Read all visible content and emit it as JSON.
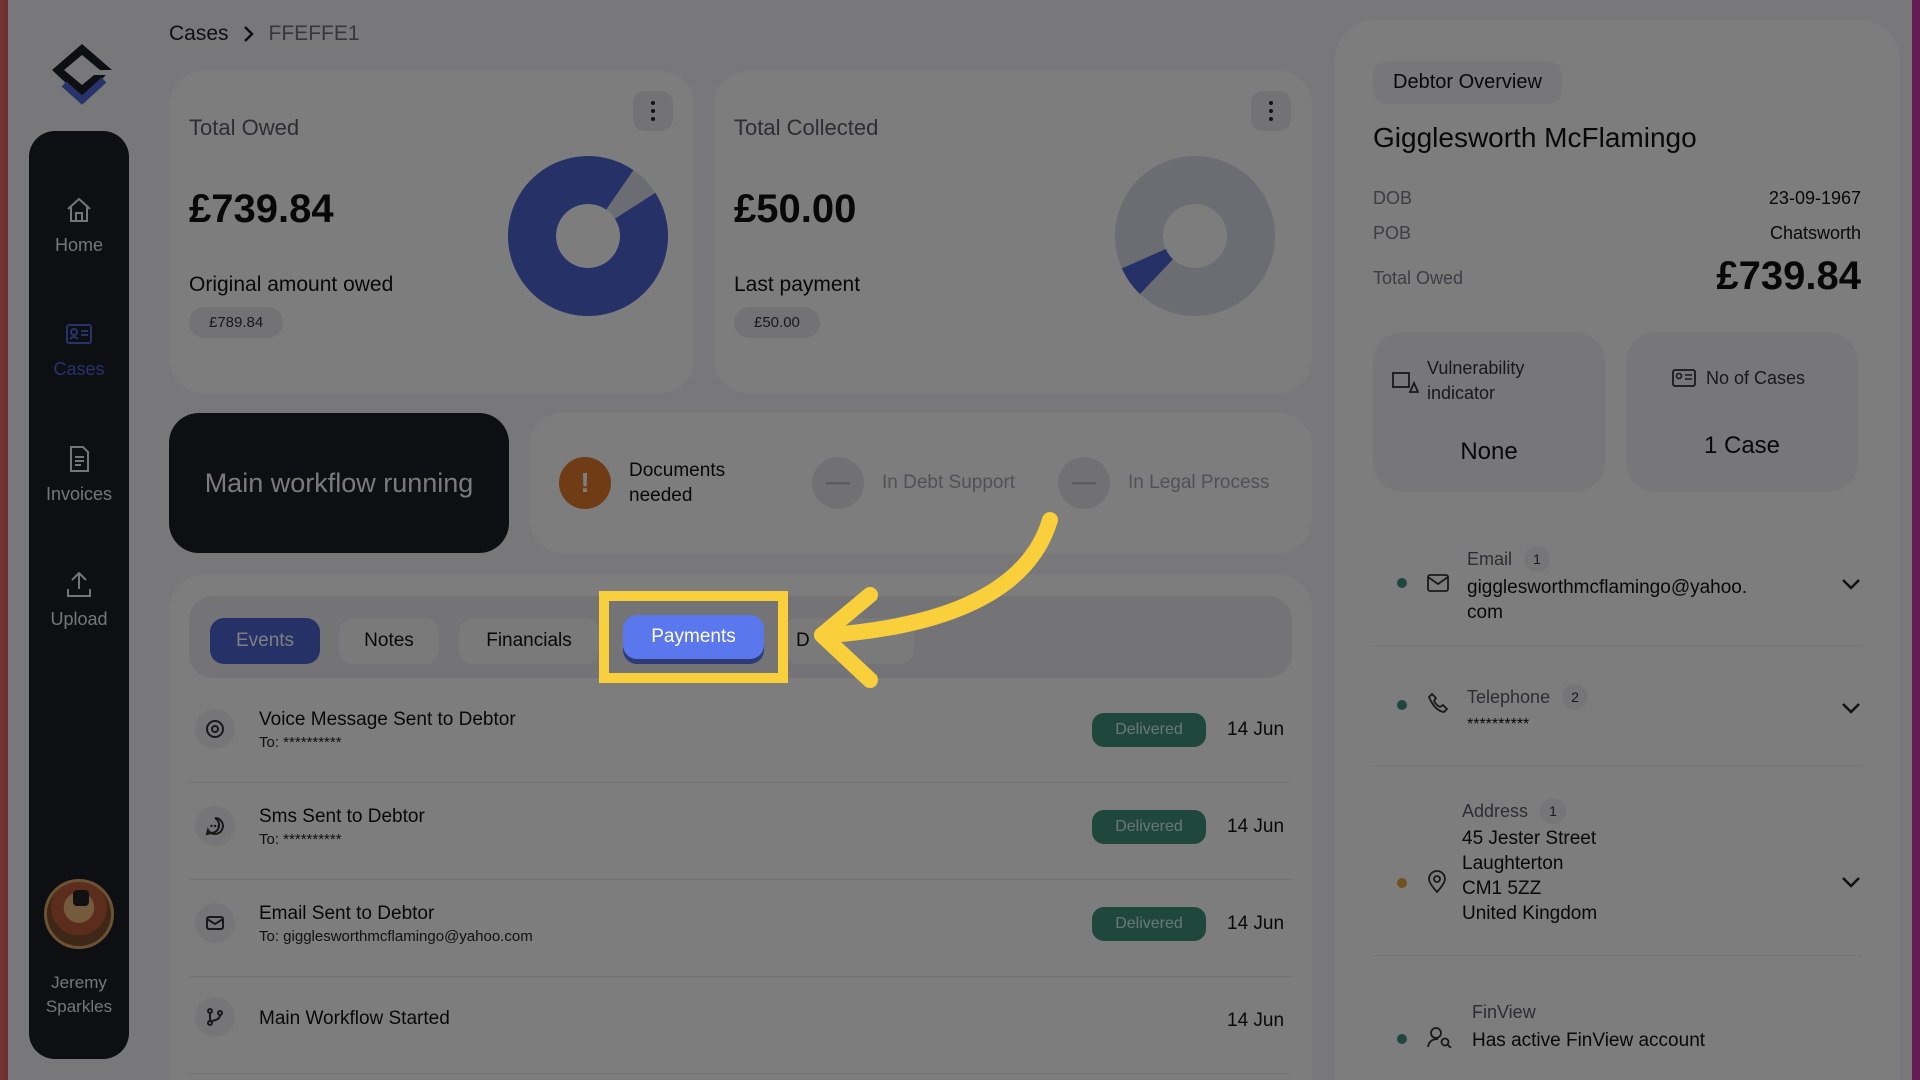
{
  "breadcrumb": {
    "root": "Cases",
    "current": "FFEFFE1"
  },
  "sidebar": {
    "items": [
      {
        "label": "Home",
        "icon": "home-icon"
      },
      {
        "label": "Cases",
        "icon": "id-card-icon"
      },
      {
        "label": "Invoices",
        "icon": "document-icon"
      },
      {
        "label": "Upload",
        "icon": "upload-icon"
      }
    ],
    "user": {
      "name_line1": "Jeremy",
      "name_line2": "Sparkles"
    }
  },
  "total_owed": {
    "title": "Total Owed",
    "value": "£739.84",
    "sub_label": "Original amount owed",
    "sub_value": "£789.84",
    "fraction": 0.937
  },
  "total_collected": {
    "title": "Total Collected",
    "value": "£50.00",
    "sub_label": "Last payment",
    "sub_value": "£50.00",
    "fraction": 0.063
  },
  "workflow": {
    "label": "Main workflow running"
  },
  "steps": [
    {
      "icon": "!",
      "label_line1": "Documents",
      "label_line2": "needed"
    },
    {
      "icon": "—",
      "label": "In Debt Support"
    },
    {
      "icon": "—",
      "label": "In Legal Process"
    }
  ],
  "tabs": [
    "Events",
    "Notes",
    "Financials",
    "Payments",
    "D"
  ],
  "events": [
    {
      "title": "Voice Message Sent to Debtor",
      "sub": "To: **********",
      "status": "Delivered",
      "date": "14 Jun",
      "icon": "voicemail-icon"
    },
    {
      "title": "Sms Sent to Debtor",
      "sub": "To: **********",
      "status": "Delivered",
      "date": "14 Jun",
      "icon": "sms-icon"
    },
    {
      "title": "Email Sent to Debtor",
      "sub": "To: gigglesworthmcflamingo@yahoo.com",
      "status": "Delivered",
      "date": "14 Jun",
      "icon": "mail-icon"
    },
    {
      "title": "Main Workflow Started",
      "sub": "",
      "status": "",
      "date": "14 Jun",
      "icon": "branch-icon"
    }
  ],
  "debtor": {
    "overview_label": "Debtor Overview",
    "name": "Gigglesworth McFlamingo",
    "dob_label": "DOB",
    "dob": "23-09-1967",
    "pob_label": "POB",
    "pob": "Chatsworth",
    "total_label": "Total Owed",
    "total": "£739.84",
    "vulnerability_label_1": "Vulnerability",
    "vulnerability_label_2": "indicator",
    "vulnerability_value": "None",
    "cases_label": "No of Cases",
    "cases_value": "1 Case",
    "email": {
      "label": "Email",
      "count": "1",
      "line1": "gigglesworthmcflamingo@yahoo.",
      "line2": "com"
    },
    "telephone": {
      "label": "Telephone",
      "count": "2",
      "value": "**********"
    },
    "address": {
      "label": "Address",
      "count": "1",
      "line1": "45 Jester Street",
      "line2": "Laughterton",
      "line3": "CM1 5ZZ",
      "line4": "United Kingdom"
    },
    "finview": {
      "label": "FinView",
      "value": "Has active FinView account"
    }
  },
  "colors": {
    "accent": "#4a63cf",
    "sidebar": "#1b1e26",
    "delivered": "#3f8f78",
    "warning": "#e0782a",
    "highlight": "#f9cf3c"
  }
}
